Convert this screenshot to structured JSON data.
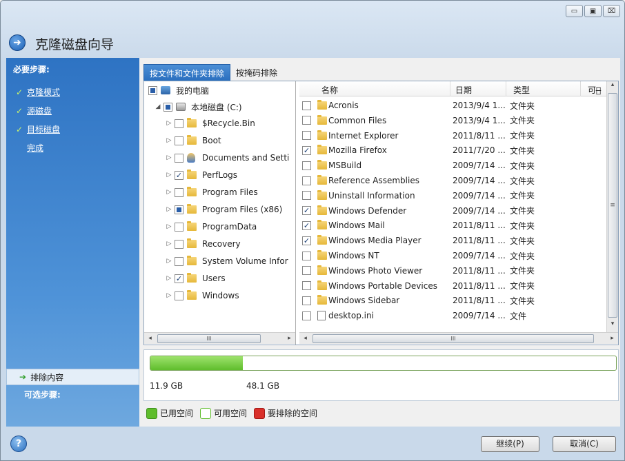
{
  "window": {
    "title": "克隆磁盘向导",
    "min_glyph": "▭",
    "max_glyph": "▣",
    "close_glyph": "⌧"
  },
  "sidebar": {
    "required_header": "必要步骤:",
    "steps": [
      {
        "label": "克隆模式",
        "done": true
      },
      {
        "label": "源磁盘",
        "done": true
      },
      {
        "label": "目标磁盘",
        "done": true
      },
      {
        "label": "完成",
        "done": false
      }
    ],
    "optional_header": "可选步骤:",
    "selected_item": "排除内容"
  },
  "tabs": [
    {
      "label": "按文件和文件夹排除",
      "active": true
    },
    {
      "label": "按掩码排除",
      "active": false
    }
  ],
  "tree": {
    "root": "我的电脑",
    "drive": "本地磁盘 (C:)",
    "items": [
      {
        "label": "$Recycle.Bin",
        "state": "none",
        "icon": "folder-icon"
      },
      {
        "label": "Boot",
        "state": "none",
        "icon": "folder-icon"
      },
      {
        "label": "Documents and Setti",
        "state": "none",
        "icon": "user-icon"
      },
      {
        "label": "PerfLogs",
        "state": "checked",
        "icon": "folder-icon"
      },
      {
        "label": "Program Files",
        "state": "none",
        "icon": "folder-icon"
      },
      {
        "label": "Program Files (x86)",
        "state": "partial",
        "icon": "folder-icon"
      },
      {
        "label": "ProgramData",
        "state": "none",
        "icon": "folder-icon"
      },
      {
        "label": "Recovery",
        "state": "none",
        "icon": "folder-icon"
      },
      {
        "label": "System Volume Infor",
        "state": "none",
        "icon": "folder-icon"
      },
      {
        "label": "Users",
        "state": "checked",
        "icon": "folder-icon"
      },
      {
        "label": "Windows",
        "state": "none",
        "icon": "folder-icon"
      }
    ],
    "scroll_glyph": "III"
  },
  "list": {
    "columns": [
      "名称",
      "日期",
      "类型",
      "可用̶"
    ],
    "rows": [
      {
        "name": "Acronis",
        "date": "2013/9/4 1...",
        "type": "文件夹",
        "checked": false,
        "icon": "folder-icon"
      },
      {
        "name": "Common Files",
        "date": "2013/9/4 1...",
        "type": "文件夹",
        "checked": false,
        "icon": "folder-icon"
      },
      {
        "name": "Internet Explorer",
        "date": "2011/8/11 ...",
        "type": "文件夹",
        "checked": false,
        "icon": "folder-icon"
      },
      {
        "name": "Mozilla Firefox",
        "date": "2011/7/20 ...",
        "type": "文件夹",
        "checked": true,
        "icon": "folder-icon"
      },
      {
        "name": "MSBuild",
        "date": "2009/7/14 ...",
        "type": "文件夹",
        "checked": false,
        "icon": "folder-icon"
      },
      {
        "name": "Reference Assemblies",
        "date": "2009/7/14 ...",
        "type": "文件夹",
        "checked": false,
        "icon": "folder-icon"
      },
      {
        "name": "Uninstall Information",
        "date": "2009/7/14 ...",
        "type": "文件夹",
        "checked": false,
        "icon": "folder-icon"
      },
      {
        "name": "Windows Defender",
        "date": "2009/7/14 ...",
        "type": "文件夹",
        "checked": true,
        "icon": "folder-icon"
      },
      {
        "name": "Windows Mail",
        "date": "2011/8/11 ...",
        "type": "文件夹",
        "checked": true,
        "icon": "folder-icon"
      },
      {
        "name": "Windows Media Player",
        "date": "2011/8/11 ...",
        "type": "文件夹",
        "checked": true,
        "icon": "folder-icon"
      },
      {
        "name": "Windows NT",
        "date": "2009/7/14 ...",
        "type": "文件夹",
        "checked": false,
        "icon": "folder-icon"
      },
      {
        "name": "Windows Photo Viewer",
        "date": "2011/8/11 ...",
        "type": "文件夹",
        "checked": false,
        "icon": "folder-icon"
      },
      {
        "name": "Windows Portable Devices",
        "date": "2011/8/11 ...",
        "type": "文件夹",
        "checked": false,
        "icon": "folder-icon"
      },
      {
        "name": "Windows Sidebar",
        "date": "2011/8/11 ...",
        "type": "文件夹",
        "checked": false,
        "icon": "folder-icon"
      },
      {
        "name": "desktop.ini",
        "date": "2009/7/14 ...",
        "type": "文件",
        "checked": false,
        "icon": "file-icon"
      }
    ],
    "scroll_glyph": "III",
    "vscroll_glyph": "≡"
  },
  "disk": {
    "used_fraction": 0.198,
    "used_label": "11.9 GB",
    "total_label": "48.1 GB"
  },
  "legend": [
    {
      "label": "已用空间",
      "color": "#5fbd2c"
    },
    {
      "label": "可用空间",
      "color": "#ffffff"
    },
    {
      "label": "要排除的空间",
      "color": "#d9302a"
    }
  ],
  "buttons": {
    "continue": "继续(P)",
    "cancel": "取消(C)",
    "help": "?"
  }
}
